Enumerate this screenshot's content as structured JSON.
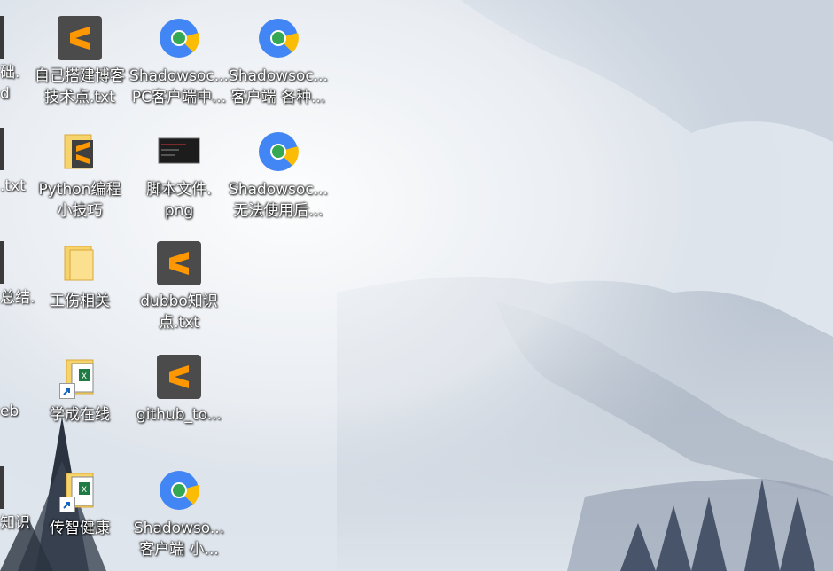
{
  "desktop": {
    "partial_labels": [
      {
        "line1": "础.",
        "line2": "d"
      },
      {
        "line1": ".txt",
        "line2": ""
      },
      {
        "line1": "总结.",
        "line2": ""
      },
      {
        "line1": "eb",
        "line2": ""
      },
      {
        "line1": "知识",
        "line2": ""
      }
    ],
    "icons": [
      {
        "name": "blog-setup-notes",
        "icon": "sublime-text-icon",
        "line1": "自己搭建博客",
        "line2": "技术点.txt"
      },
      {
        "name": "shadowsocks-pc-client",
        "icon": "chrome-html-icon",
        "line1": "Shadowsoc...",
        "line2": "PC客户端中..."
      },
      {
        "name": "shadowsocks-client-types",
        "icon": "chrome-html-icon",
        "line1": "Shadowsoc...",
        "line2": "客户端 各种..."
      },
      {
        "name": "python-tips-folder",
        "icon": "folder-icon",
        "line1": "Python编程",
        "line2": "小技巧"
      },
      {
        "name": "script-file-png",
        "icon": "image-file-icon",
        "line1": "脚本文件.",
        "line2": "png"
      },
      {
        "name": "shadowsocks-cannot-use",
        "icon": "chrome-html-icon",
        "line1": "Shadowsoc...",
        "line2": "无法使用后..."
      },
      {
        "name": "work-injury-folder",
        "icon": "folder-icon",
        "line1": "工伤相关",
        "line2": ""
      },
      {
        "name": "dubbo-knowledge",
        "icon": "sublime-text-icon",
        "line1": "dubbo知识",
        "line2": "点.txt"
      },
      {
        "name": "xuecheng-online",
        "icon": "excel-shortcut-icon",
        "line1": "学成在线",
        "line2": ""
      },
      {
        "name": "github-to",
        "icon": "sublime-text-icon",
        "line1": "github_to...",
        "line2": ""
      },
      {
        "name": "chuanzhi-health",
        "icon": "excel-shortcut-icon",
        "line1": "传智健康",
        "line2": ""
      },
      {
        "name": "shadowsocks-client-small",
        "icon": "chrome-html-icon",
        "line1": "Shadowso...",
        "line2": "客户端 小..."
      }
    ]
  }
}
